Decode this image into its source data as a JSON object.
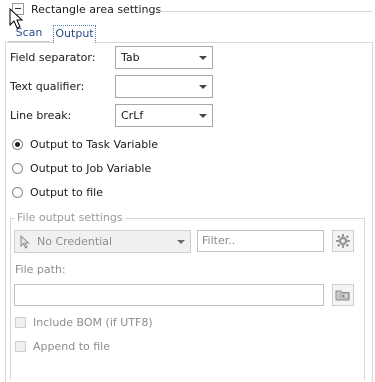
{
  "section": {
    "title": "Rectangle area settings"
  },
  "tabs": [
    {
      "label": "Scan",
      "selected": false
    },
    {
      "label": "Output",
      "selected": true
    }
  ],
  "form": {
    "field_separator": {
      "label": "Field separator:",
      "value": "Tab"
    },
    "text_qualifier": {
      "label": "Text qualifier:",
      "value": ""
    },
    "line_break": {
      "label": "Line break:",
      "value": "CrLf"
    }
  },
  "output_options": [
    {
      "label": "Output to Task Variable",
      "checked": true
    },
    {
      "label": "Output to Job Variable",
      "checked": false
    },
    {
      "label": "Output to file",
      "checked": false
    }
  ],
  "file_output": {
    "group_title": "File output settings",
    "credential": {
      "value": "No Credential",
      "icon": "pointer-cursor-icon"
    },
    "filter": {
      "placeholder": "Filter..",
      "button_icon": "gear-icon"
    },
    "file_path": {
      "label": "File path:",
      "value": "",
      "button_icon": "browse-folder-icon"
    },
    "include_bom": {
      "label": "Include BOM (if UTF8)",
      "checked": false,
      "enabled": false
    },
    "append_to_file": {
      "label": "Append to file",
      "checked": false,
      "enabled": false
    }
  }
}
